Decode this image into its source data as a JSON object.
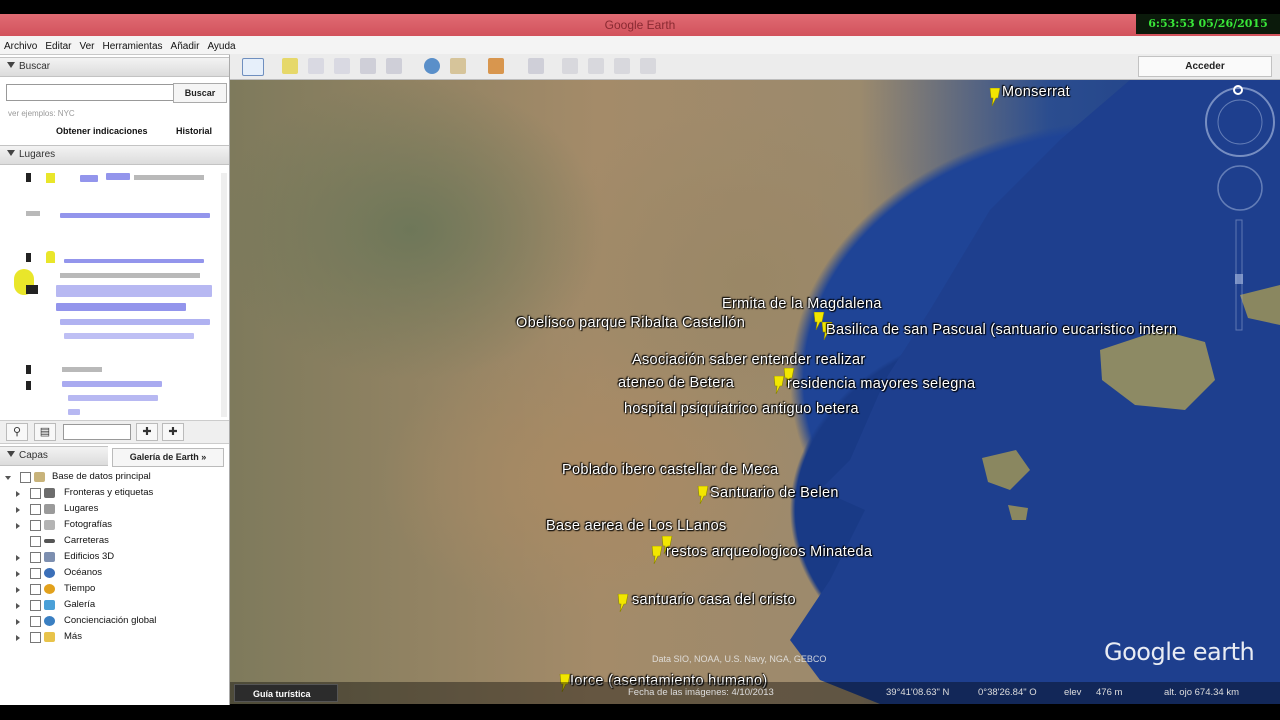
{
  "window": {
    "title": "Google Earth",
    "clock": "6:53:53  05/26/2015"
  },
  "menu": [
    "Archivo",
    "Editar",
    "Ver",
    "Herramientas",
    "Añadir",
    "Ayuda"
  ],
  "toolbar": {
    "sign_in": "Acceder"
  },
  "search": {
    "header": "Buscar",
    "button": "Buscar",
    "hint": "ver ejemplos: NYC",
    "directions": "Obtener indicaciones",
    "history": "Historial"
  },
  "places": {
    "header": "Lugares"
  },
  "layers": {
    "header": "Capas",
    "gallery_button": "Galería de Earth »",
    "items": [
      {
        "label": "Base de datos principal"
      },
      {
        "label": "Fronteras y etiquetas"
      },
      {
        "label": "Lugares"
      },
      {
        "label": "Fotografías"
      },
      {
        "label": "Carreteras"
      },
      {
        "label": "Edificios 3D"
      },
      {
        "label": "Océanos"
      },
      {
        "label": "Tiempo"
      },
      {
        "label": "Galería"
      },
      {
        "label": "Concienciación global"
      },
      {
        "label": "Más"
      }
    ]
  },
  "map": {
    "labels": [
      "Monserrat",
      "Ermita de la Magdalena",
      "Obelisco parque Ribalta Castellón",
      "Basilica de san Pascual (santuario eucaristico intern",
      "Asociación saber entender realizar",
      "ateneo de Betera",
      "residencia mayores selegna",
      "hospital psiquiatrico antiguo betera",
      "Poblado ibero castellar de Meca",
      "Santuario de Belen",
      "Base aerea de Los LLanos",
      "restos arqueologicos  Minateda",
      "santuario casa del cristo",
      "Iorce (asentamiento humano)"
    ],
    "logo_a": "Google",
    "logo_b": " earth",
    "copyright": "Data SIO, NOAA, U.S. Navy, NGA, GEBCO",
    "status": {
      "tour": "Guía turística",
      "imagery_date": "Fecha de las imágenes: 4/10/2013",
      "lat": "39°41'08.63\" N",
      "lon": "0°38'26.84\" O",
      "elev": "elev",
      "elev_val": "476 m",
      "alt": "alt. ojo 674.34 km"
    }
  },
  "colors": {
    "title_bar": "#d9575f",
    "clock_text": "#39e639",
    "sea": "#1f4496",
    "pin": "#f2e600"
  }
}
